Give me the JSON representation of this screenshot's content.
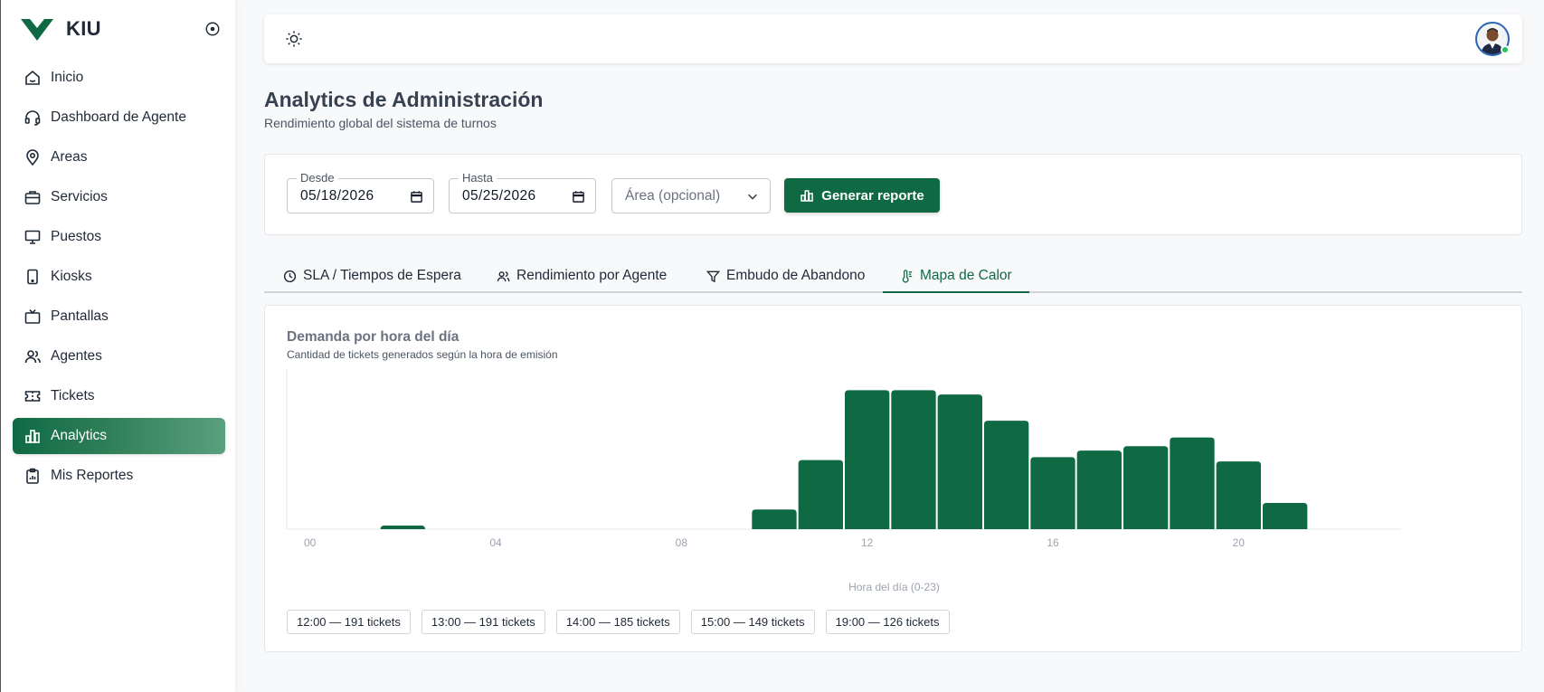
{
  "brand": {
    "name": "KIU",
    "color": "#0f6a44"
  },
  "sidebar": {
    "items": [
      {
        "label": "Inicio",
        "icon": "home-icon",
        "active": false
      },
      {
        "label": "Dashboard de Agente",
        "icon": "headset-icon",
        "active": false
      },
      {
        "label": "Areas",
        "icon": "map-pin-icon",
        "active": false
      },
      {
        "label": "Servicios",
        "icon": "briefcase-icon",
        "active": false
      },
      {
        "label": "Puestos",
        "icon": "monitor-icon",
        "active": false
      },
      {
        "label": "Kiosks",
        "icon": "tablet-icon",
        "active": false
      },
      {
        "label": "Pantallas",
        "icon": "tv-icon",
        "active": false
      },
      {
        "label": "Agentes",
        "icon": "users-icon",
        "active": false
      },
      {
        "label": "Tickets",
        "icon": "ticket-icon",
        "active": false
      },
      {
        "label": "Analytics",
        "icon": "bar-chart-icon",
        "active": true
      },
      {
        "label": "Mis Reportes",
        "icon": "clipboard-icon",
        "active": false
      }
    ]
  },
  "header": {
    "title": "Analytics de Administración",
    "subtitle": "Rendimiento global del sistema de turnos"
  },
  "filters": {
    "from_label": "Desde",
    "from_value": "05/18/2026",
    "to_label": "Hasta",
    "to_value": "05/25/2026",
    "area_placeholder": "Área (opcional)",
    "generate_label": "Generar reporte"
  },
  "tabs": [
    {
      "label": "SLA / Tiempos de Espera",
      "icon": "clock-icon",
      "active": false
    },
    {
      "label": "Rendimiento por Agente",
      "icon": "users-icon",
      "active": false
    },
    {
      "label": "Embudo de Abandono",
      "icon": "filter-icon",
      "active": false
    },
    {
      "label": "Mapa de Calor",
      "icon": "thermometer-icon",
      "active": true
    }
  ],
  "chart_data": {
    "type": "bar",
    "title": "Demanda por hora del día",
    "subtitle": "Cantidad de tickets generados según la hora de emisión",
    "xlabel": "Hora del día (0-23)",
    "ylabel": "",
    "x": [
      0,
      1,
      2,
      3,
      4,
      5,
      6,
      7,
      8,
      9,
      10,
      11,
      12,
      13,
      14,
      15,
      16,
      17,
      18,
      19,
      20,
      21,
      22,
      23
    ],
    "values": [
      0,
      0,
      5,
      0,
      0,
      0,
      0,
      0,
      0,
      0,
      27,
      95,
      191,
      191,
      185,
      149,
      99,
      108,
      114,
      126,
      93,
      36,
      0,
      0
    ],
    "x_ticks": [
      "00",
      "04",
      "08",
      "12",
      "16",
      "20"
    ],
    "ylim": [
      0,
      220
    ],
    "color": "#0f6a44",
    "grid": false,
    "legend": "none"
  },
  "top_hours": [
    "12:00 — 191 tickets",
    "13:00 — 191 tickets",
    "14:00 — 185 tickets",
    "15:00 — 149 tickets",
    "19:00 — 126 tickets"
  ]
}
